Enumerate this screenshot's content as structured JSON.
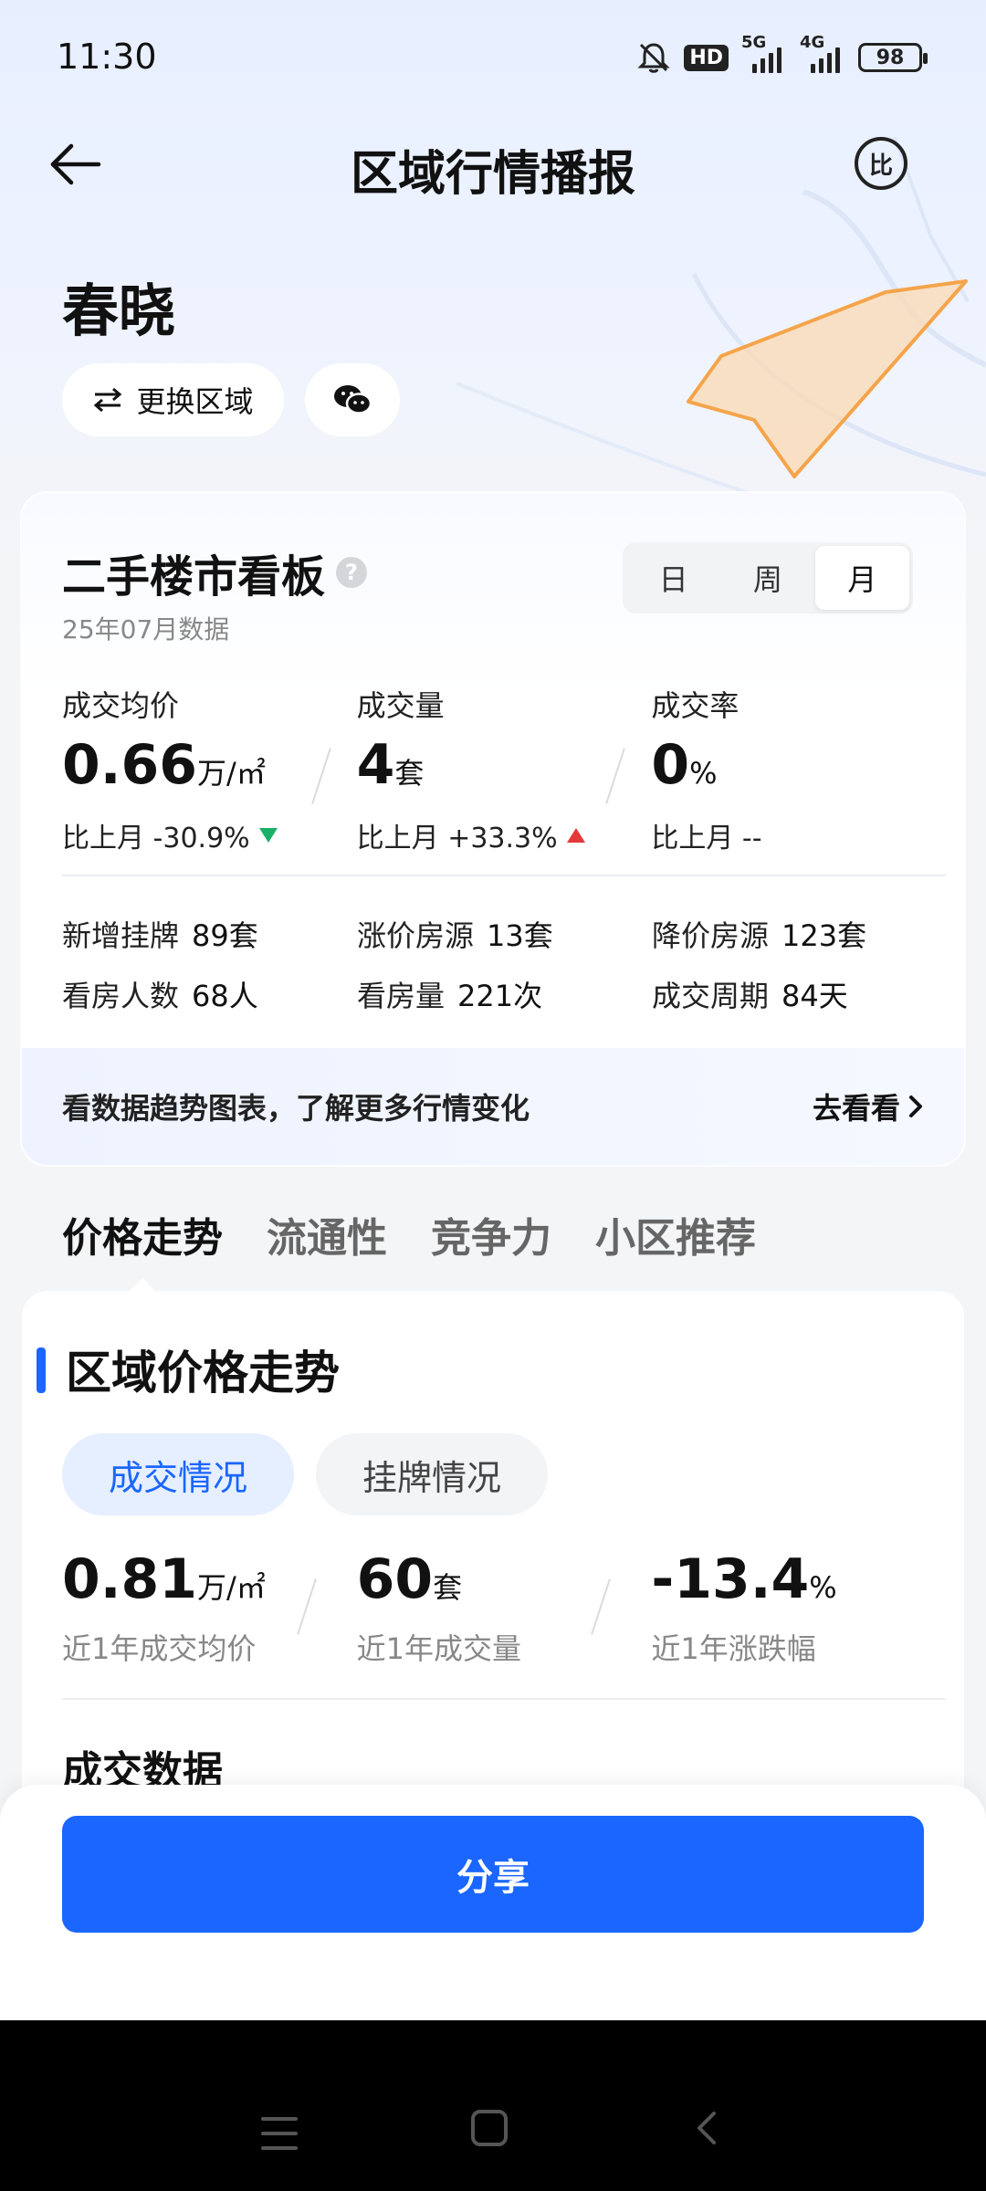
{
  "status_bar": {
    "time": "11:30",
    "hd_label": "HD",
    "network_1": "5G",
    "network_2": "4G",
    "battery": "98"
  },
  "header": {
    "title": "区域行情播报",
    "compare_label": "比"
  },
  "area": {
    "name": "春晓",
    "change_button": "更换区域"
  },
  "board": {
    "title": "二手楼市看板",
    "subtitle": "25年07月数据",
    "periods": [
      "日",
      "周",
      "月"
    ],
    "metrics": [
      {
        "label": "成交均价",
        "value": "0.66",
        "unit": "万/㎡",
        "change": "比上月 -30.9%"
      },
      {
        "label": "成交量",
        "value": "4",
        "unit": "套",
        "change": "比上月 +33.3%"
      },
      {
        "label": "成交率",
        "value": "0",
        "unit": "%",
        "change": "比上月 --"
      }
    ],
    "stats": [
      {
        "label": "新增挂牌",
        "value": "89套"
      },
      {
        "label": "涨价房源",
        "value": "13套"
      },
      {
        "label": "降价房源",
        "value": "123套"
      },
      {
        "label": "看房人数",
        "value": "68人"
      },
      {
        "label": "看房量",
        "value": "221次"
      },
      {
        "label": "成交周期",
        "value": "84天"
      }
    ],
    "trend_text": "看数据趋势图表，了解更多行情变化",
    "trend_link": "去看看"
  },
  "tabs": [
    "价格走势",
    "流通性",
    "竞争力",
    "小区推荐"
  ],
  "price_section": {
    "title": "区域价格走势",
    "pill_active": "成交情况",
    "pill_inactive": "挂牌情况",
    "metrics": [
      {
        "value": "0.81",
        "unit": "万/㎡",
        "label": "近1年成交均价"
      },
      {
        "value": "60",
        "unit": "套",
        "label": "近1年成交量"
      },
      {
        "value": "-13.4",
        "unit": "%",
        "label": "近1年涨跌幅"
      }
    ],
    "deal_title": "成交数据"
  },
  "share_button": "分享",
  "colors": {
    "accent": "#1a66ff",
    "down": "#1bb06a",
    "up": "#e5383b",
    "region_fill": "#fbd9b3",
    "region_stroke": "#f5a44a"
  }
}
